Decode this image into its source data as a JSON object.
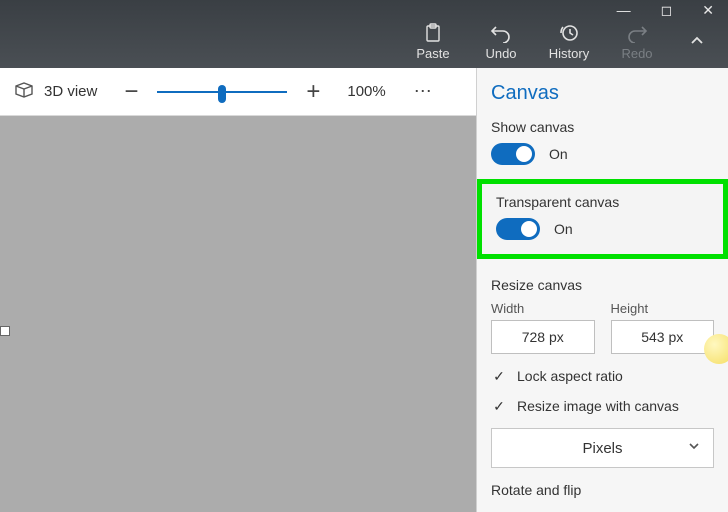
{
  "titlebar": {
    "buttons": {
      "paste": "Paste",
      "undo": "Undo",
      "history": "History",
      "redo": "Redo"
    }
  },
  "toolbar": {
    "view3d": "3D view",
    "zoom_percent": "100%"
  },
  "panel": {
    "title": "Canvas",
    "show_canvas_label": "Show canvas",
    "show_canvas_state": "On",
    "transparent_label": "Transparent canvas",
    "transparent_state": "On",
    "resize_label": "Resize canvas",
    "width_label": "Width",
    "height_label": "Height",
    "width_value": "728 px",
    "height_value": "543 px",
    "lock_aspect": "Lock aspect ratio",
    "resize_with_canvas": "Resize image with canvas",
    "unit": "Pixels",
    "rotate_label": "Rotate and flip"
  }
}
